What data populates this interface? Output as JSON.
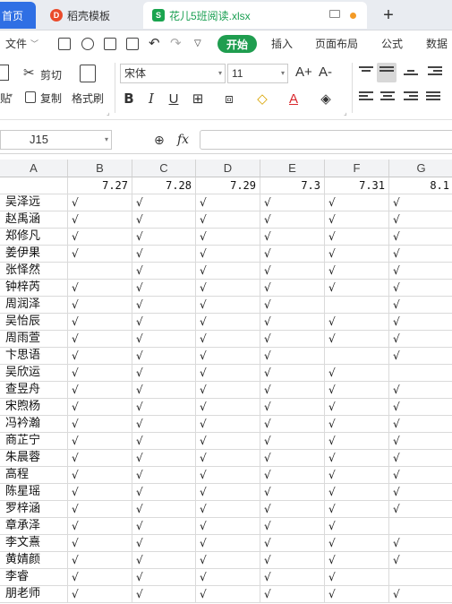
{
  "tabs": {
    "home": "首页",
    "template": "稻壳模板",
    "file": "花儿5班阅读.xlsx",
    "new_tab": "+"
  },
  "menu": {
    "file": "文件",
    "start": "开始",
    "insert": "插入",
    "page_layout": "页面布局",
    "formula": "公式",
    "data": "数据"
  },
  "ribbon": {
    "cut": "剪切",
    "copy": "复制",
    "paste_tail": "贴",
    "format_painter": "格式刷",
    "font_name": "宋体",
    "font_size": "11",
    "grow_font": "A+",
    "shrink_font": "A-",
    "bold": "B",
    "italic": "I",
    "underline": "U",
    "font_color_letter": "A"
  },
  "formula_bar": {
    "cell_ref": "J15",
    "fx": "fx",
    "value": ""
  },
  "sheet": {
    "columns": [
      "A",
      "B",
      "C",
      "D",
      "E",
      "F",
      "G"
    ],
    "dates": [
      "",
      "7.27",
      "7.28",
      "7.29",
      "7.3",
      "7.31",
      "8.1"
    ],
    "rows": [
      {
        "name": "吴泽远",
        "marks": [
          "√",
          "√",
          "√",
          "√",
          "√",
          "√"
        ]
      },
      {
        "name": "赵禹涵",
        "marks": [
          "√",
          "√",
          "√",
          "√",
          "√",
          "√"
        ]
      },
      {
        "name": "郑修凡",
        "marks": [
          "√",
          "√",
          "√",
          "√",
          "√",
          "√"
        ]
      },
      {
        "name": "姜伊果",
        "marks": [
          "√",
          "√",
          "√",
          "√",
          "√",
          "√"
        ]
      },
      {
        "name": "张怿然",
        "marks": [
          "",
          "√",
          "√",
          "√",
          "√",
          "√"
        ]
      },
      {
        "name": "钟梓芮",
        "marks": [
          "√",
          "√",
          "√",
          "√",
          "√",
          "√"
        ]
      },
      {
        "name": "周润泽",
        "marks": [
          "√",
          "√",
          "√",
          "√",
          "",
          "√"
        ]
      },
      {
        "name": "吴怡辰",
        "marks": [
          "√",
          "√",
          "√",
          "√",
          "√",
          "√"
        ]
      },
      {
        "name": "周雨萱",
        "marks": [
          "√",
          "√",
          "√",
          "√",
          "√",
          "√"
        ]
      },
      {
        "name": "卞思语",
        "marks": [
          "√",
          "√",
          "√",
          "√",
          "",
          "√"
        ]
      },
      {
        "name": "吴欣运",
        "marks": [
          "√",
          "√",
          "√",
          "√",
          "√",
          ""
        ]
      },
      {
        "name": "查昱舟",
        "marks": [
          "√",
          "√",
          "√",
          "√",
          "√",
          "√"
        ]
      },
      {
        "name": "宋煦杨",
        "marks": [
          "√",
          "√",
          "√",
          "√",
          "√",
          "√"
        ]
      },
      {
        "name": "冯衿瀚",
        "marks": [
          "√",
          "√",
          "√",
          "√",
          "√",
          "√"
        ]
      },
      {
        "name": "商芷宁",
        "marks": [
          "√",
          "√",
          "√",
          "√",
          "√",
          "√"
        ]
      },
      {
        "name": "朱晨蓉",
        "marks": [
          "√",
          "√",
          "√",
          "√",
          "√",
          "√"
        ]
      },
      {
        "name": "高程",
        "marks": [
          "√",
          "√",
          "√",
          "√",
          "√",
          "√"
        ]
      },
      {
        "name": "陈星瑶",
        "marks": [
          "√",
          "√",
          "√",
          "√",
          "√",
          "√"
        ]
      },
      {
        "name": "罗梓涵",
        "marks": [
          "√",
          "√",
          "√",
          "√",
          "√",
          "√"
        ]
      },
      {
        "name": "章承泽",
        "marks": [
          "√",
          "√",
          "√",
          "√",
          "√",
          ""
        ]
      },
      {
        "name": "李文熹",
        "marks": [
          "√",
          "√",
          "√",
          "√",
          "√",
          "√"
        ]
      },
      {
        "name": "黄婧颜",
        "marks": [
          "√",
          "√",
          "√",
          "√",
          "√",
          "√"
        ]
      },
      {
        "name": "李睿",
        "marks": [
          "√",
          "√",
          "√",
          "√",
          "√",
          ""
        ]
      },
      {
        "name": "朋老师",
        "marks": [
          "√",
          "√",
          "√",
          "√",
          "√",
          "√"
        ]
      }
    ]
  },
  "colors": {
    "accent_green": "#1f9d4f",
    "home_tab_blue": "#2f6fe4"
  }
}
